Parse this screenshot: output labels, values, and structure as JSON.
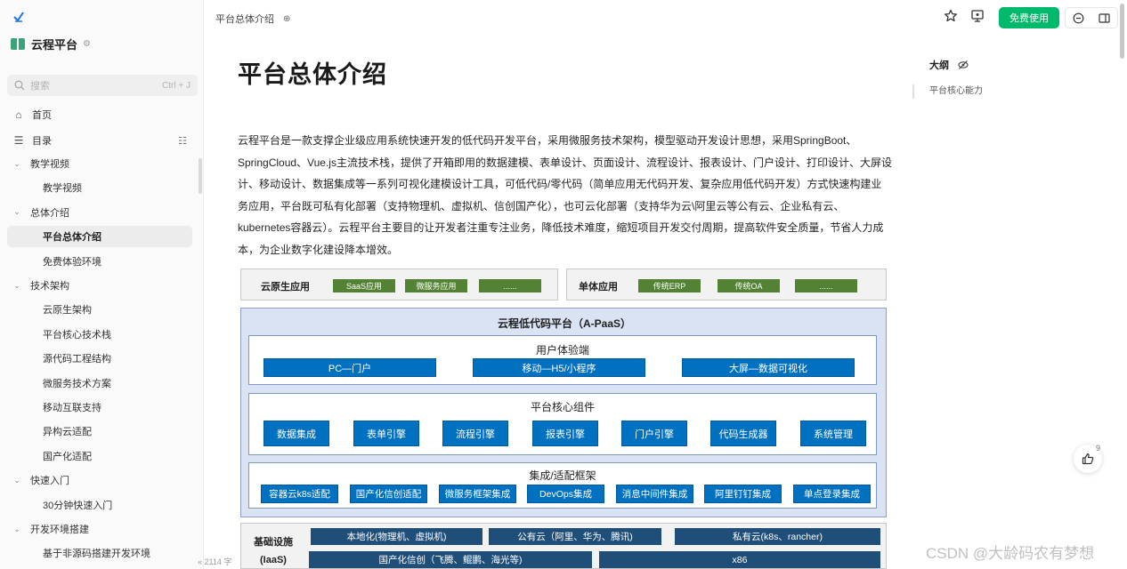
{
  "sidebar": {
    "workspace_title": "云程平台",
    "search_placeholder": "搜索",
    "search_shortcut": "Ctrl + J",
    "home_label": "首页",
    "toc_label": "目录",
    "tree": [
      {
        "label": "教学视频",
        "level": 1
      },
      {
        "label": "教学视频",
        "level": 2
      },
      {
        "label": "总体介绍",
        "level": 1
      },
      {
        "label": "平台总体介绍",
        "level": 2,
        "active": true
      },
      {
        "label": "免费体验环境",
        "level": 2
      },
      {
        "label": "技术架构",
        "level": 1
      },
      {
        "label": "云原生架构",
        "level": 2
      },
      {
        "label": "平台核心技术栈",
        "level": 2
      },
      {
        "label": "源代码工程结构",
        "level": 2
      },
      {
        "label": "微服务技术方案",
        "level": 2
      },
      {
        "label": "移动互联支持",
        "level": 2
      },
      {
        "label": "异构云适配",
        "level": 2
      },
      {
        "label": "国产化适配",
        "level": 2
      },
      {
        "label": "快速入门",
        "level": 1
      },
      {
        "label": "30分钟快速入门",
        "level": 2
      },
      {
        "label": "开发环境搭建",
        "level": 1
      },
      {
        "label": "基于非源码搭建开发环境",
        "level": 2
      }
    ],
    "word_count": "2114 字"
  },
  "header": {
    "breadcrumb": "平台总体介绍",
    "free_button": "免费使用"
  },
  "doc": {
    "title": "平台总体介绍",
    "paragraph": "云程平台是一款支撑企业级应用系统快速开发的低代码开发平台，采用微服务技术架构，模型驱动开发设计思想，采用SpringBoot、SpringCloud、Vue.js主流技术栈，提供了开箱即用的数据建模、表单设计、页面设计、流程设计、报表设计、门户设计、打印设计、大屏设计、移动设计、数据集成等一系列可视化建模设计工具，可低代码/零代码（简单应用无代码开发、复杂应用低代码开发）方式快速构建业务应用，平台既可私有化部署（支持物理机、虚拟机、信创国产化），也可云化部署（支持华为云\\阿里云等公有云、企业私有云、kubernetes容器云）。云程平台主要目的让开发者注重专注业务，降低技术难度，缩短项目开发交付周期，提高软件安全质量，节省人力成本，为企业数字化建设降本增效。"
  },
  "outline": {
    "title": "大纲",
    "items": [
      "平台核心能力"
    ]
  },
  "like_count": "9",
  "watermark": "CSDN @大龄码农有梦想",
  "diagram": {
    "cloud_native": {
      "label": "云原生应用",
      "items": [
        "SaaS应用",
        "微服务应用",
        "......"
      ]
    },
    "monolith": {
      "label": "单体应用",
      "items": [
        "传统ERP",
        "传统OA",
        "......"
      ]
    },
    "paas_title": "云程低代码平台（A-PaaS）",
    "ux": {
      "title": "用户体验端",
      "items": [
        "PC—门户",
        "移动—H5/小程序",
        "大屏—数据可视化"
      ]
    },
    "core": {
      "title": "平台核心组件",
      "items": [
        "数据集成",
        "表单引擎",
        "流程引擎",
        "报表引擎",
        "门户引擎",
        "代码生成器",
        "系统管理"
      ]
    },
    "integration": {
      "title": "集成/适配框架",
      "items": [
        "容器云k8s适配",
        "国产化信创适配",
        "微服务框架集成",
        "DevOps集成",
        "消息中间件集成",
        "阿里钉钉集成",
        "单点登录集成"
      ]
    },
    "iaas": {
      "label_line1": "基础设施",
      "label_line2": "(IaaS)",
      "row1": [
        "本地化(物理机、虚拟机)",
        "公有云（阿里、华为、腾讯)",
        "私有云(k8s、rancher)"
      ],
      "row2": [
        "国产化信创（飞腾、鲲鹏、海光等)",
        "x86"
      ]
    }
  },
  "colors": {
    "accent_green": "#00b96b",
    "diagram_blue": "#0070c0",
    "diagram_green": "#548235",
    "diagram_navy": "#1f4e79"
  }
}
